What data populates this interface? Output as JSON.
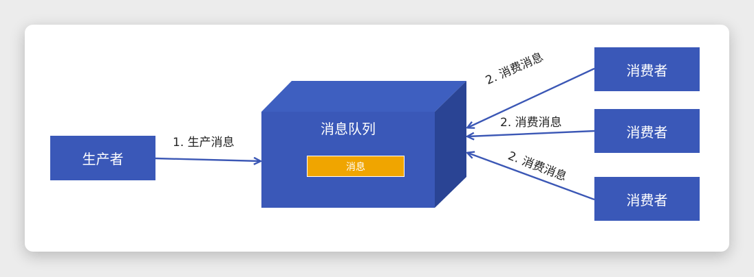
{
  "producer": {
    "label": "生产者"
  },
  "queue": {
    "label": "消息队列",
    "message_label": "消息"
  },
  "consumers": [
    {
      "label": "消费者"
    },
    {
      "label": "消费者"
    },
    {
      "label": "消费者"
    }
  ],
  "edges": {
    "produce_label": "1. 生产消息",
    "consume_labels": [
      "2. 消费消息",
      "2. 消费消息",
      "2. 消费消息"
    ]
  },
  "colors": {
    "node_fill": "#3a58b8",
    "cube_top": "#3e5fc0",
    "cube_side": "#2a4494",
    "message_fill": "#f0a500",
    "arrow": "#3b57b5"
  }
}
